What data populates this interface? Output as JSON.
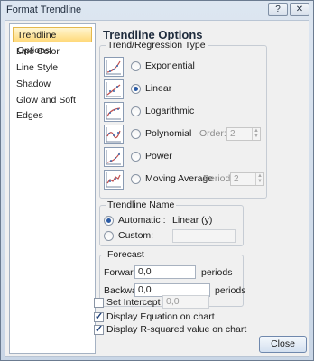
{
  "window": {
    "title": "Format Trendline",
    "help_glyph": "?",
    "close_glyph": "✕"
  },
  "sidebar": {
    "items": [
      {
        "label": "Trendline Options",
        "active": true
      },
      {
        "label": "Line Color"
      },
      {
        "label": "Line Style"
      },
      {
        "label": "Shadow"
      },
      {
        "label": "Glow and Soft Edges"
      }
    ]
  },
  "main": {
    "heading": "Trendline Options",
    "type_group": {
      "label": "Trend/Regression Type",
      "options": [
        {
          "label": "Exponential",
          "selected": false,
          "icon": "exponential-icon"
        },
        {
          "label": "Linear",
          "selected": true,
          "icon": "linear-icon"
        },
        {
          "label": "Logarithmic",
          "selected": false,
          "icon": "logarithmic-icon"
        },
        {
          "label": "Polynomial",
          "selected": false,
          "icon": "polynomial-icon"
        },
        {
          "label": "Power",
          "selected": false,
          "icon": "power-icon"
        },
        {
          "label": "Moving Average",
          "selected": false,
          "icon": "moving-average-icon"
        }
      ],
      "order_label": "Order:",
      "order_value": "2",
      "period_label": "Period:",
      "period_value": "2"
    },
    "name_group": {
      "label": "Trendline Name",
      "automatic_label": "Automatic :",
      "automatic_value": "Linear (y)",
      "custom_label": "Custom:"
    },
    "forecast_group": {
      "label": "Forecast",
      "forward_label": "Forward:",
      "forward_value": "0,0",
      "backward_label": "Backward:",
      "backward_value": "0,0",
      "unit": "periods"
    },
    "set_intercept": {
      "label": "Set Intercept =",
      "value": "0,0",
      "checked": false
    },
    "display_equation": {
      "label": "Display Equation on chart",
      "checked": true
    },
    "display_r_squared": {
      "label": "Display R-squared value on chart",
      "checked": true
    }
  },
  "footer": {
    "close_label": "Close"
  },
  "colors": {
    "accent": "#ffd97a",
    "window_frame": "#c9d6e6"
  }
}
